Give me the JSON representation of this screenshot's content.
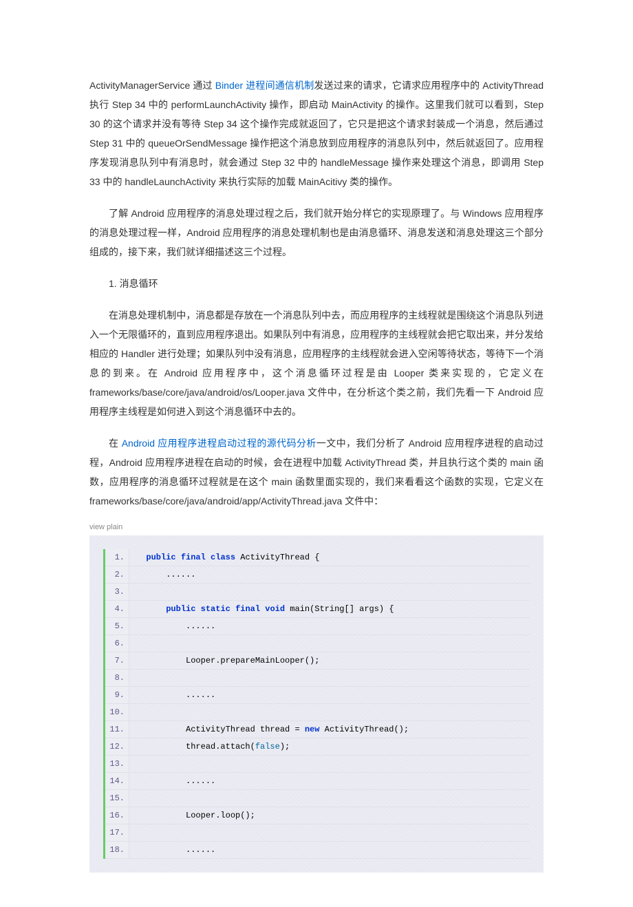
{
  "para1": {
    "t1": "ActivityManagerService 通过 ",
    "link1": "Binder 进程间通信机制",
    "t2": "发送过来的请求，它请求应用程序中的 ActivityThread 执行 Step 34 中的 performLaunchActivity 操作，即启动 MainActivity 的操作。这里我们就可以看到，Step 30 的这个请求并没有等待 Step 34 这个操作完成就返回了，它只是把这个请求封装成一个消息，然后通过 Step 31 中的 queueOrSendMessage 操作把这个消息放到应用程序的消息队列中，然后就返回了。应用程序发现消息队列中有消息时，就会通过 Step 32 中的 handleMessage 操作来处理这个消息，即调用 Step 33 中的 handleLaunchActivity 来执行实际的加载 MainAcitivy 类的操作。"
  },
  "para2": "了解 Android 应用程序的消息处理过程之后，我们就开始分样它的实现原理了。与 Windows 应用程序的消息处理过程一样，Android 应用程序的消息处理机制也是由消息循环、消息发送和消息处理这三个部分组成的，接下来，我们就详细描述这三个过程。",
  "section1_title": "1. 消息循环",
  "para3": "在消息处理机制中，消息都是存放在一个消息队列中去，而应用程序的主线程就是围绕这个消息队列进入一个无限循环的，直到应用程序退出。如果队列中有消息，应用程序的主线程就会把它取出来，并分发给相应的 Handler 进行处理；如果队列中没有消息，应用程序的主线程就会进入空闲等待状态，等待下一个消息的到来。在 Android 应用程序中，这个消息循环过程是由 Looper 类来实现的，它定义在 frameworks/base/core/java/android/os/Looper.java 文件中，在分析这个类之前，我们先看一下 Android 应用程序主线程是如何进入到这个消息循环中去的。",
  "para4": {
    "t1": "在 ",
    "link1": "Android 应用程序进程启动过程的源代码分析",
    "t2": "一文中，我们分析了 Android 应用程序进程的启动过程，Android 应用程序进程在启动的时候，会在进程中加载 ActivityThread 类，并且执行这个类的 main 函数，应用程序的消息循环过程就是在这个 main 函数里面实现的，我们来看看这个函数的实现，它定义在 frameworks/base/core/java/android/app/ActivityThread.java 文件中："
  },
  "view_plain": "view plain",
  "code": {
    "lines": [
      {
        "n": "1.",
        "tokens": [
          {
            "t": "  "
          },
          {
            "t": "public",
            "c": "kw"
          },
          {
            "t": " "
          },
          {
            "t": "final",
            "c": "kw"
          },
          {
            "t": " "
          },
          {
            "t": "class",
            "c": "kw"
          },
          {
            "t": " ActivityThread {"
          }
        ]
      },
      {
        "n": "2.",
        "tokens": [
          {
            "t": "      ......"
          }
        ]
      },
      {
        "n": "3.",
        "tokens": [
          {
            "t": ""
          }
        ]
      },
      {
        "n": "4.",
        "tokens": [
          {
            "t": "      "
          },
          {
            "t": "public",
            "c": "kw"
          },
          {
            "t": " "
          },
          {
            "t": "static",
            "c": "kw"
          },
          {
            "t": " "
          },
          {
            "t": "final",
            "c": "kw"
          },
          {
            "t": " "
          },
          {
            "t": "void",
            "c": "kw"
          },
          {
            "t": " main(String[] args) {"
          }
        ]
      },
      {
        "n": "5.",
        "tokens": [
          {
            "t": "          ......"
          }
        ]
      },
      {
        "n": "6.",
        "tokens": [
          {
            "t": ""
          }
        ]
      },
      {
        "n": "7.",
        "tokens": [
          {
            "t": "          Looper.prepareMainLooper();"
          }
        ]
      },
      {
        "n": "8.",
        "tokens": [
          {
            "t": ""
          }
        ]
      },
      {
        "n": "9.",
        "tokens": [
          {
            "t": "          ......"
          }
        ]
      },
      {
        "n": "10.",
        "tokens": [
          {
            "t": ""
          }
        ]
      },
      {
        "n": "11.",
        "tokens": [
          {
            "t": "          ActivityThread thread = "
          },
          {
            "t": "new",
            "c": "kw"
          },
          {
            "t": " ActivityThread();"
          }
        ]
      },
      {
        "n": "12.",
        "tokens": [
          {
            "t": "          thread.attach("
          },
          {
            "t": "false",
            "c": "lit"
          },
          {
            "t": ");"
          }
        ]
      },
      {
        "n": "13.",
        "tokens": [
          {
            "t": ""
          }
        ]
      },
      {
        "n": "14.",
        "tokens": [
          {
            "t": "          ......"
          }
        ]
      },
      {
        "n": "15.",
        "tokens": [
          {
            "t": ""
          }
        ]
      },
      {
        "n": "16.",
        "tokens": [
          {
            "t": "          Looper.loop();"
          }
        ]
      },
      {
        "n": "17.",
        "tokens": [
          {
            "t": ""
          }
        ]
      },
      {
        "n": "18.",
        "tokens": [
          {
            "t": "          ......"
          }
        ]
      }
    ]
  }
}
